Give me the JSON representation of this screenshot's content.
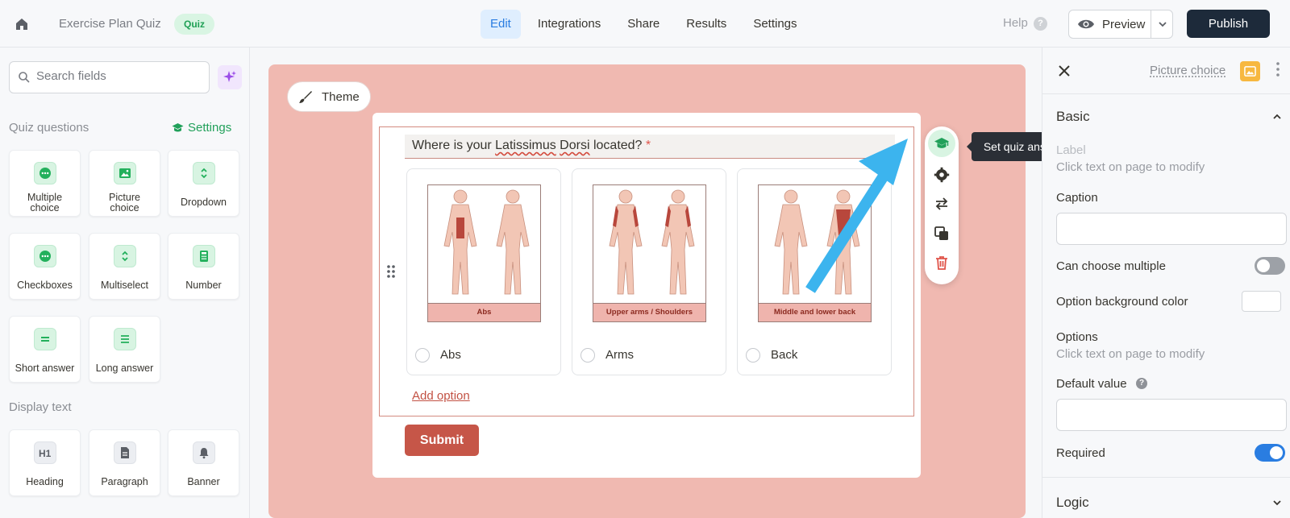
{
  "topbar": {
    "title": "Exercise Plan Quiz",
    "badge": "Quiz",
    "nav": [
      "Edit",
      "Integrations",
      "Share",
      "Results",
      "Settings"
    ],
    "active_nav": "Edit",
    "help": "Help",
    "preview": "Preview",
    "publish": "Publish"
  },
  "sidebar": {
    "search_placeholder": "Search fields",
    "quiz_section": "Quiz questions",
    "quiz_settings": "Settings",
    "quiz_tiles": [
      {
        "l1": "Multiple",
        "l2": "choice",
        "icon": "dots-circle-icon"
      },
      {
        "l1": "Picture",
        "l2": "choice",
        "icon": "image-icon"
      },
      {
        "l1": "Dropdown",
        "icon": "chevron-updown-icon"
      },
      {
        "l1": "Checkboxes",
        "icon": "dots-circle-icon"
      },
      {
        "l1": "Multiselect",
        "icon": "chevron-updown-icon"
      },
      {
        "l1": "Number",
        "icon": "calculator-icon"
      },
      {
        "l1": "Short answer",
        "icon": "short-lines-icon"
      },
      {
        "l1": "Long answer",
        "icon": "long-lines-icon"
      }
    ],
    "display_section": "Display text",
    "display_tiles": [
      {
        "l1": "Heading",
        "icon": "h1-icon"
      },
      {
        "l1": "Paragraph",
        "icon": "document-icon"
      },
      {
        "l1": "Banner",
        "icon": "bell-icon"
      }
    ]
  },
  "canvas": {
    "theme": "Theme",
    "question": {
      "pre": "Where is your ",
      "w1": "Latissimus",
      "mid": " ",
      "w2": "Dorsi",
      "post": " located?",
      "required": "*"
    },
    "options": [
      {
        "caption": "Abs",
        "label": "Abs"
      },
      {
        "caption": "Upper arms / Shoulders",
        "label": "Arms"
      },
      {
        "caption": "Middle and lower back",
        "label": "Back"
      }
    ],
    "add_option": "Add option",
    "submit": "Submit",
    "tooltip": "Set quiz answer key",
    "accent_color": "#c65648",
    "bg_color": "#f0b9b1"
  },
  "panel": {
    "type": "Picture choice",
    "basic": "Basic",
    "label_title": "Label",
    "label_hint": "Click text on page to modify",
    "caption": "Caption",
    "caption_value": "",
    "can_choose_multiple": "Can choose multiple",
    "option_bg": "Option background color",
    "options_title": "Options",
    "options_hint": "Click text on page to modify",
    "default_value": "Default value",
    "default_value_value": "",
    "required": "Required",
    "logic": "Logic",
    "can_choose_multiple_on": false,
    "required_on": true
  }
}
